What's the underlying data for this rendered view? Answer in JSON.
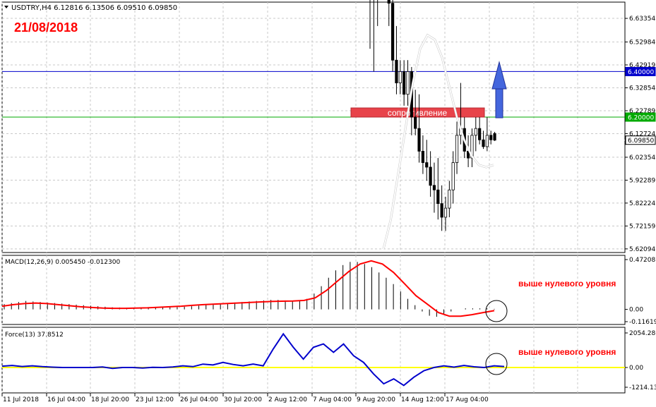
{
  "header": {
    "symbol_line": "USDTRY,H4  6.12816 6.13506 6.09510 6.09850",
    "date_label": "21/08/2018"
  },
  "colors": {
    "up_candle": "#ffffff",
    "down_candle": "#000000",
    "ma_line": "#ffffff",
    "level_640": "#0000cc",
    "level_620": "#00aa00",
    "resistance_box": "#e8434a",
    "arrow": "#4466dd",
    "macd_signal": "#ff0000",
    "force_line": "#0000cc",
    "zero_line": "#ffff00",
    "annotation_text": "#ff0000"
  },
  "annotations": {
    "resistance_label": "сопротивление",
    "macd_note": "выше нулевого уровня",
    "force_note": "выше нулевого уровня"
  },
  "chart_data": [
    {
      "type": "candlestick",
      "panel": "price",
      "title": "USDTRY,H4",
      "ohlc_last": {
        "open": 6.12816,
        "high": 6.13506,
        "low": 6.0951,
        "close": 6.0985
      },
      "y_ticks": [
        "6.63354",
        "6.52984",
        "6.42919",
        "6.32854",
        "6.22789",
        "6.12724",
        "6.02354",
        "5.92289",
        "5.82224",
        "5.72159",
        "5.62094"
      ],
      "ylim": [
        5.605,
        6.705
      ],
      "horizontal_levels": [
        {
          "value": 6.4,
          "label": "6.40000",
          "color": "#0000cc"
        },
        {
          "value": 6.2,
          "label": "6.20000",
          "color": "#00aa00"
        },
        {
          "value": 6.0985,
          "label": "6.09850",
          "color": "#ffffff"
        }
      ],
      "candles": [
        [
          7.2,
          7.4,
          6.5,
          6.8
        ],
        [
          6.8,
          7.1,
          6.4,
          6.9
        ],
        [
          6.9,
          7.3,
          6.6,
          7.1
        ],
        [
          7.1,
          7.2,
          6.9,
          7.0
        ],
        [
          7.0,
          7.1,
          6.8,
          6.9
        ],
        [
          6.9,
          7.0,
          6.6,
          6.7
        ],
        [
          6.7,
          6.8,
          6.4,
          6.45
        ],
        [
          6.45,
          6.6,
          6.3,
          6.35
        ],
        [
          6.35,
          6.45,
          6.3,
          6.4
        ],
        [
          6.4,
          6.45,
          6.25,
          6.3
        ],
        [
          6.3,
          6.45,
          6.25,
          6.4
        ],
        [
          6.4,
          6.42,
          6.12,
          6.2
        ],
        [
          6.2,
          6.32,
          6.12,
          6.15
        ],
        [
          6.15,
          6.3,
          6.0,
          6.05
        ],
        [
          6.05,
          6.12,
          5.95,
          6.0
        ],
        [
          6.0,
          6.1,
          5.92,
          5.98
        ],
        [
          5.98,
          6.05,
          5.85,
          5.9
        ],
        [
          5.9,
          6.0,
          5.78,
          5.88
        ],
        [
          5.88,
          6.02,
          5.75,
          5.82
        ],
        [
          5.82,
          5.9,
          5.7,
          5.76
        ],
        [
          5.76,
          5.85,
          5.7,
          5.8
        ],
        [
          5.8,
          5.92,
          5.76,
          5.88
        ],
        [
          5.88,
          6.05,
          5.82,
          6.0
        ],
        [
          6.0,
          6.18,
          5.95,
          6.12
        ],
        [
          6.12,
          6.35,
          6.08,
          6.15
        ],
        [
          6.15,
          6.2,
          6.02,
          6.05
        ],
        [
          6.05,
          6.12,
          5.98,
          6.02
        ],
        [
          6.02,
          6.15,
          5.98,
          6.12
        ],
        [
          6.12,
          6.2,
          6.05,
          6.15
        ],
        [
          6.15,
          6.2,
          6.08,
          6.1
        ],
        [
          6.1,
          6.14,
          6.06,
          6.07
        ],
        [
          6.07,
          6.2,
          6.05,
          6.12
        ],
        [
          6.12,
          6.14,
          6.08,
          6.1
        ],
        [
          6.12816,
          6.13506,
          6.0951,
          6.0985
        ]
      ],
      "moving_average": [
        5.62,
        5.75,
        5.95,
        6.15,
        6.35,
        6.5,
        6.56,
        6.54,
        6.46,
        6.33,
        6.2,
        6.1,
        6.03,
        5.99,
        5.98,
        5.99
      ]
    },
    {
      "type": "histogram",
      "panel": "macd",
      "title": "MACD(12,26,9) 0.005450 -0.012300",
      "y_ticks": [
        "0.472087",
        "0.00",
        "-0.116198"
      ],
      "ylim": [
        -0.116198,
        0.472087
      ],
      "histogram": [
        0.05,
        0.06,
        0.07,
        0.08,
        0.075,
        0.07,
        0.065,
        0.06,
        0.055,
        0.05,
        0.045,
        0.04,
        0.035,
        0.03,
        0.025,
        0.02,
        0.018,
        0.015,
        0.015,
        0.015,
        0.015,
        0.016,
        0.018,
        0.02,
        0.022,
        0.025,
        0.03,
        0.035,
        0.045,
        0.05,
        0.055,
        0.06,
        0.065,
        0.07,
        0.075,
        0.08,
        0.085,
        0.09,
        0.09,
        0.085,
        0.08,
        0.08,
        0.1,
        0.15,
        0.22,
        0.3,
        0.37,
        0.42,
        0.45,
        0.45,
        0.43,
        0.4,
        0.35,
        0.3,
        0.24,
        0.17,
        0.1,
        0.04,
        -0.02,
        -0.06,
        -0.07,
        -0.05,
        -0.02,
        0.0,
        0.01,
        0.01,
        0.01,
        0.01,
        0.005
      ],
      "signal": [
        0.03,
        0.045,
        0.055,
        0.06,
        0.055,
        0.045,
        0.035,
        0.025,
        0.018,
        0.012,
        0.01,
        0.01,
        0.012,
        0.015,
        0.02,
        0.025,
        0.03,
        0.038,
        0.045,
        0.05,
        0.055,
        0.06,
        0.065,
        0.07,
        0.075,
        0.078,
        0.08,
        0.085,
        0.11,
        0.18,
        0.27,
        0.36,
        0.43,
        0.46,
        0.43,
        0.35,
        0.24,
        0.13,
        0.05,
        -0.03,
        -0.065,
        -0.065,
        -0.05,
        -0.03,
        -0.012
      ]
    },
    {
      "type": "line",
      "panel": "force",
      "title": "Force(13) 37.8512",
      "y_ticks": [
        "2054.286",
        "0.00",
        "-1214.137"
      ],
      "ylim": [
        -1214.137,
        2054.286
      ],
      "values": [
        80,
        120,
        60,
        100,
        50,
        20,
        0,
        0,
        0,
        0,
        30,
        -50,
        0,
        0,
        -30,
        10,
        0,
        30,
        100,
        50,
        200,
        150,
        300,
        180,
        100,
        200,
        100,
        1100,
        2000,
        1200,
        500,
        1200,
        1400,
        900,
        1400,
        700,
        300,
        -400,
        -1000,
        -700,
        -1100,
        -600,
        -200,
        0,
        100,
        20,
        120,
        40,
        0,
        100,
        60
      ],
      "xlim": [
        0,
        62
      ]
    }
  ],
  "x_axis": {
    "labels": [
      "11 Jul 2018",
      "16 Jul 04:00",
      "18 Jul 20:00",
      "23 Jul 12:00",
      "26 Jul 04:00",
      "30 Jul 20:00",
      "2 Aug 12:00",
      "7 Aug 04:00",
      "9 Aug 20:00",
      "14 Aug 12:00",
      "17 Aug 04:00"
    ]
  }
}
